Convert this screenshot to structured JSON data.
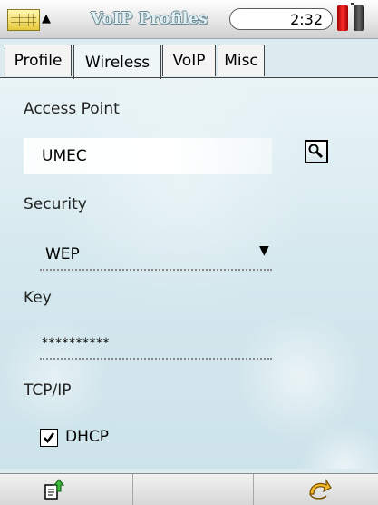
{
  "header": {
    "title": "VoIP Profiles",
    "clock": "2:32",
    "icons": [
      "keyboard-icon",
      "up-arrow-icon",
      "battery-icon"
    ]
  },
  "tabs": [
    {
      "label": "Profile",
      "active": false
    },
    {
      "label": "Wireless",
      "active": true
    },
    {
      "label": "VoIP",
      "active": false
    },
    {
      "label": "Misc",
      "active": false
    }
  ],
  "form": {
    "access_point_label": "Access Point",
    "access_point_value": "UMEC",
    "security_label": "Security",
    "security_value": "WEP",
    "key_label": "Key",
    "key_value": "**********",
    "tcpip_label": "TCP/IP",
    "dhcp_label": "DHCP",
    "dhcp_checked": true
  },
  "toolbar": {
    "icons": [
      "export-icon",
      "back-icon"
    ]
  },
  "colors": {
    "background": "#dcebf0",
    "battery": "#ff2a2a"
  }
}
